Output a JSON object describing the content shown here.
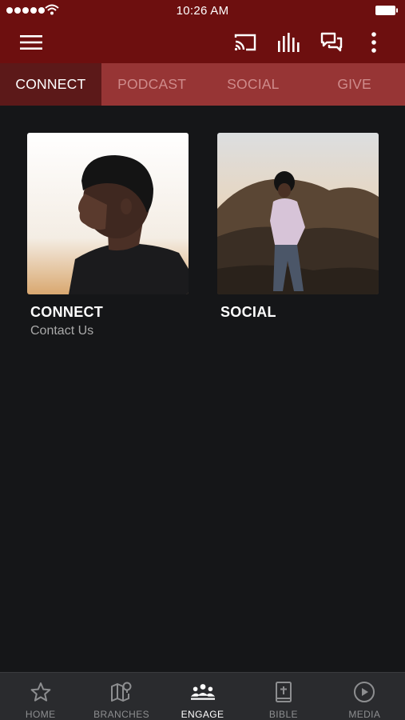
{
  "status_bar": {
    "time": "10:26 AM"
  },
  "tabs": [
    {
      "label": "CONNECT",
      "active": true
    },
    {
      "label": "PODCAST",
      "active": false
    },
    {
      "label": "SOCIAL",
      "active": false
    },
    {
      "label": "GIVE",
      "active": false
    }
  ],
  "cards": [
    {
      "title": "CONNECT",
      "subtitle": "Contact Us"
    },
    {
      "title": "SOCIAL"
    }
  ],
  "bottom_nav": [
    {
      "label": "HOME",
      "icon": "star-icon"
    },
    {
      "label": "BRANCHES",
      "icon": "map-pin-icon"
    },
    {
      "label": "ENGAGE",
      "icon": "group-icon",
      "active": true
    },
    {
      "label": "BIBLE",
      "icon": "bible-icon"
    },
    {
      "label": "MEDIA",
      "icon": "play-circle-icon"
    }
  ],
  "colors": {
    "header": "#6d0f0f",
    "tab_bar": "#973535",
    "tab_active": "#5c1919",
    "background": "#151618",
    "nav_bar": "#2a2b2e"
  }
}
